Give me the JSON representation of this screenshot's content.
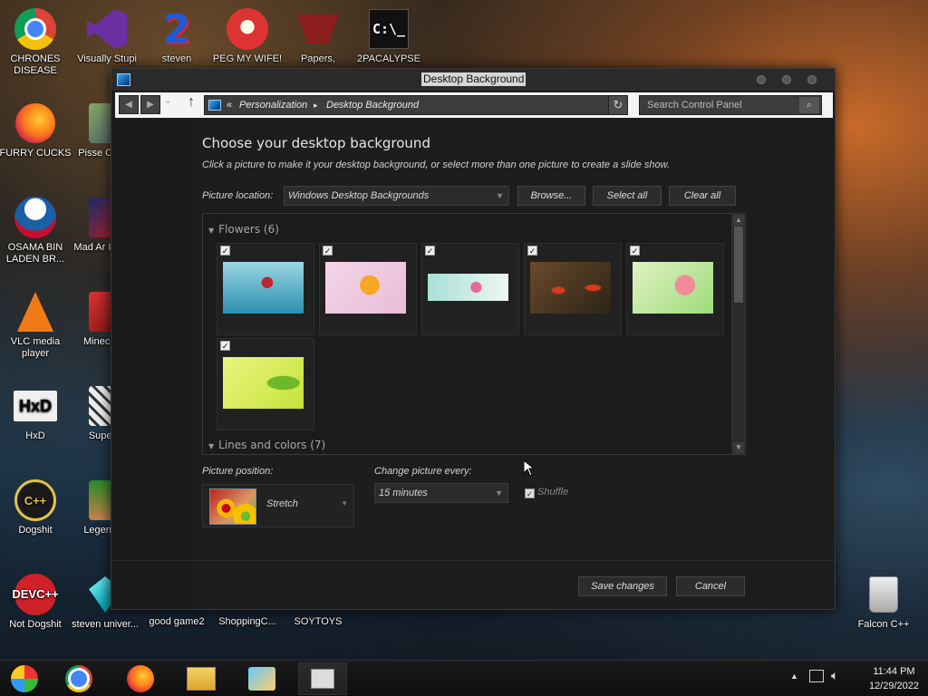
{
  "desktop": {
    "icons": [
      {
        "label": "CHRONES DISEASE",
        "icon": "chrome-icon"
      },
      {
        "label": "Visually Stupi",
        "icon": "visual-studio-icon"
      },
      {
        "label": "steven",
        "icon": "steven-icon"
      },
      {
        "label": "PEG MY WIFE!",
        "icon": "peggle-icon"
      },
      {
        "label": "Papers,",
        "icon": "papers-please-icon"
      },
      {
        "label": "2PACALYPSE",
        "icon": "cmd-icon"
      },
      {
        "label": "FURRY CUCKS",
        "icon": "firefox-icon"
      },
      {
        "label": "Pisse Chicke",
        "icon": "chicken-icon"
      },
      {
        "label": "OSAMA BIN LADEN BR...",
        "icon": "obama-icon"
      },
      {
        "label": "Mad Ar IN SPA",
        "icon": "angry-birds-space-icon"
      },
      {
        "label": "VLC media player",
        "icon": "vlc-icon"
      },
      {
        "label": "Minec Bird",
        "icon": "minecraft-bird-icon"
      },
      {
        "label": "HxD",
        "icon": "hxd-icon"
      },
      {
        "label": "Super H",
        "icon": "super-h-icon"
      },
      {
        "label": "Dogshit",
        "icon": "cpp-icon"
      },
      {
        "label": "Legen Zild",
        "icon": "zelda-icon"
      },
      {
        "label": "Not Dogshit",
        "icon": "devcpp-icon"
      },
      {
        "label": "steven univer...",
        "icon": "gem-icon"
      },
      {
        "label": "good game2",
        "icon": "game-icon"
      },
      {
        "label": "ShoppingC...",
        "icon": "shopping-icon"
      },
      {
        "label": "SOYTOYS",
        "icon": "soytoys-icon"
      },
      {
        "label": "Falcon C++",
        "icon": "recycle-bin-icon"
      }
    ],
    "icon_glyphs": {
      "hxd": "HxD",
      "cmd": "C:\\_",
      "cpp": "C++",
      "devcpp_top": "DEV",
      "devcpp_bottom": "C++"
    }
  },
  "window": {
    "title": "Desktop Background",
    "breadcrumb": {
      "sep": "«",
      "items": [
        "Personalization",
        "Desktop Background"
      ],
      "arrow": "▸"
    },
    "search_placeholder": "Search Control Panel",
    "heading": "Choose your desktop background",
    "subtitle": "Click a picture to make it your desktop background, or select more than one picture to create a slide show.",
    "picture_location_label": "Picture location:",
    "picture_location_value": "Windows Desktop Backgrounds",
    "buttons": {
      "browse": "Browse...",
      "select_all": "Select all",
      "clear_all": "Clear all",
      "save": "Save changes",
      "cancel": "Cancel"
    },
    "groups": [
      {
        "name": "Flowers (6)",
        "count": 6
      },
      {
        "name": "Lines and colors (7)",
        "count": 7
      }
    ],
    "thumbnails": [
      {
        "checked": true,
        "colors": [
          "#2a8fb0",
          "#9cd6e4",
          "#c0232f"
        ]
      },
      {
        "checked": true,
        "colors": [
          "#f4d5e6",
          "#f5a623",
          "#e9bcd7"
        ]
      },
      {
        "checked": true,
        "colors": [
          "#a8e0d6",
          "#e36a9a",
          "#f0f6f4"
        ]
      },
      {
        "checked": true,
        "colors": [
          "#2b2418",
          "#d63a1b",
          "#6b4a2a"
        ]
      },
      {
        "checked": true,
        "colors": [
          "#9fdc7a",
          "#f28a9a",
          "#dff2c4"
        ]
      },
      {
        "checked": true,
        "colors": [
          "#c6e23a",
          "#6fb827",
          "#e9f580"
        ]
      }
    ],
    "picture_position_label": "Picture position:",
    "picture_position_value": "Stretch",
    "change_every_label": "Change picture every:",
    "change_every_value": "15 minutes",
    "shuffle_label": "Shuffle",
    "shuffle_checked": true
  },
  "taskbar": {
    "items": [
      "explorer-icon",
      "chrome-icon",
      "firefox-icon",
      "file-explorer-icon",
      "control-panel-icon",
      "active-window-icon"
    ],
    "time": "11:44 PM",
    "date": "12/29/2022"
  }
}
